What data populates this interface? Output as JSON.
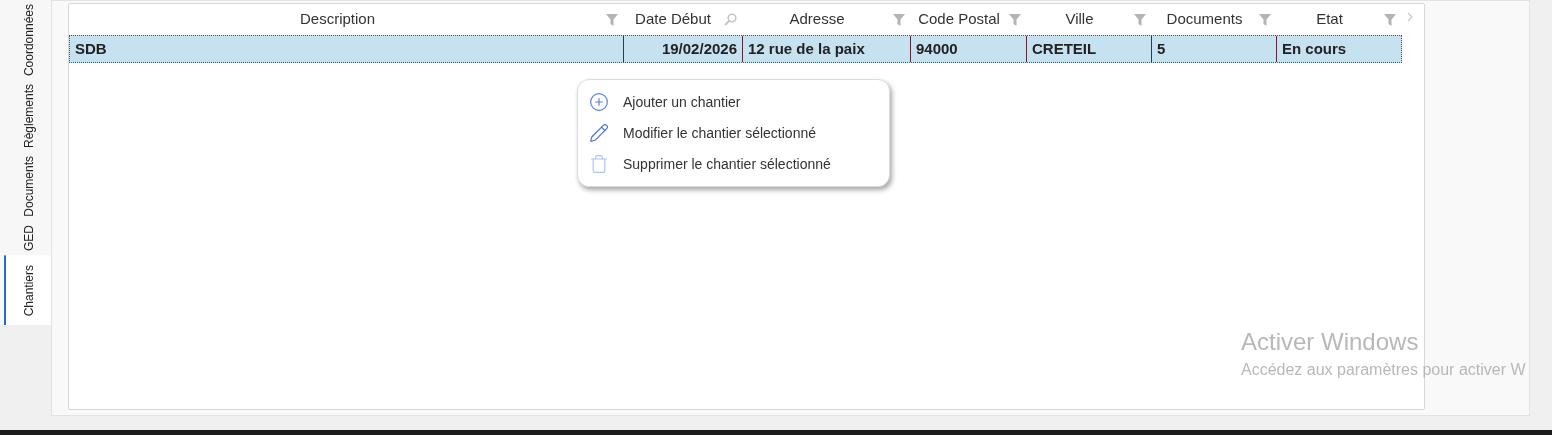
{
  "side_tabs": [
    {
      "label": "Coordonnées",
      "selected": false
    },
    {
      "label": "Règlements",
      "selected": false
    },
    {
      "label": "Documents",
      "selected": false
    },
    {
      "label": "GED",
      "selected": false
    },
    {
      "label": "Chantiers",
      "selected": true
    }
  ],
  "table": {
    "columns": [
      {
        "label": "Description",
        "kind": "text"
      },
      {
        "label": "Date Début",
        "kind": "date"
      },
      {
        "label": "Adresse",
        "kind": "text"
      },
      {
        "label": "Code Postal",
        "kind": "text"
      },
      {
        "label": "Ville",
        "kind": "text"
      },
      {
        "label": "Documents",
        "kind": "text"
      },
      {
        "label": "Etat",
        "kind": "text"
      }
    ],
    "rows": [
      {
        "selected": true,
        "cells": [
          "SDB",
          "19/02/2026",
          "12 rue de la paix",
          "94000",
          "CRETEIL",
          "5",
          "En cours"
        ]
      }
    ]
  },
  "context_menu": {
    "items": [
      {
        "kind": "add",
        "label": "Ajouter un chantier"
      },
      {
        "kind": "edit",
        "label": "Modifier le chantier sélectionné"
      },
      {
        "kind": "delete",
        "label": "Supprimer le chantier sélectionné"
      }
    ]
  },
  "activation_notice": {
    "title": "Activer Windows",
    "text": "Accédez aux paramètres pour activer W"
  }
}
